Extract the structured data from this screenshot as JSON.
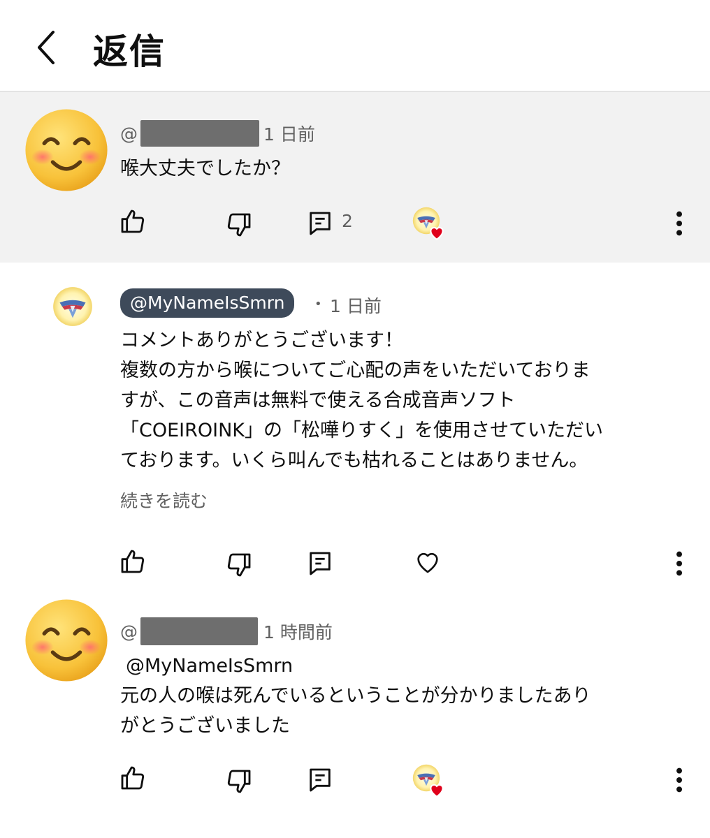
{
  "header": {
    "title": "返信"
  },
  "parent_comment": {
    "handle_prefix": "@",
    "time": "1 日前",
    "text": "喉大丈夫でしたか？",
    "reply_count": "2"
  },
  "reply_1": {
    "handle": "@MyNameIsSmrn",
    "separator": "•",
    "time": "1 日前",
    "lines": [
      "コメントありがとうございます！",
      "複数の方から喉についてご心配の声をいただいておりま",
      "すが、この音声は無料で使える合成音声ソフト",
      "「COEIROINK」の「松嘩りすく」を使用させていただい",
      "ております。いくら叫んでも枯れることはありません。"
    ],
    "read_more": "続きを読む"
  },
  "reply_2": {
    "handle_prefix": "@",
    "time": "1 時間前",
    "mention": "@MyNameIsSmrn",
    "lines": [
      "元の人の喉は死んでいるということが分かりましたあり",
      "がとうございました"
    ]
  },
  "icons": {
    "back": "chevron-left-icon",
    "like": "thumbs-up-icon",
    "dislike": "thumbs-down-icon",
    "reply": "comment-icon",
    "heart": "heart-icon",
    "more": "more-vertical-icon"
  },
  "colors": {
    "chip_bg": "#3e4a5a",
    "heart_red": "#e0001b",
    "parent_bg": "#f2f2f2"
  }
}
